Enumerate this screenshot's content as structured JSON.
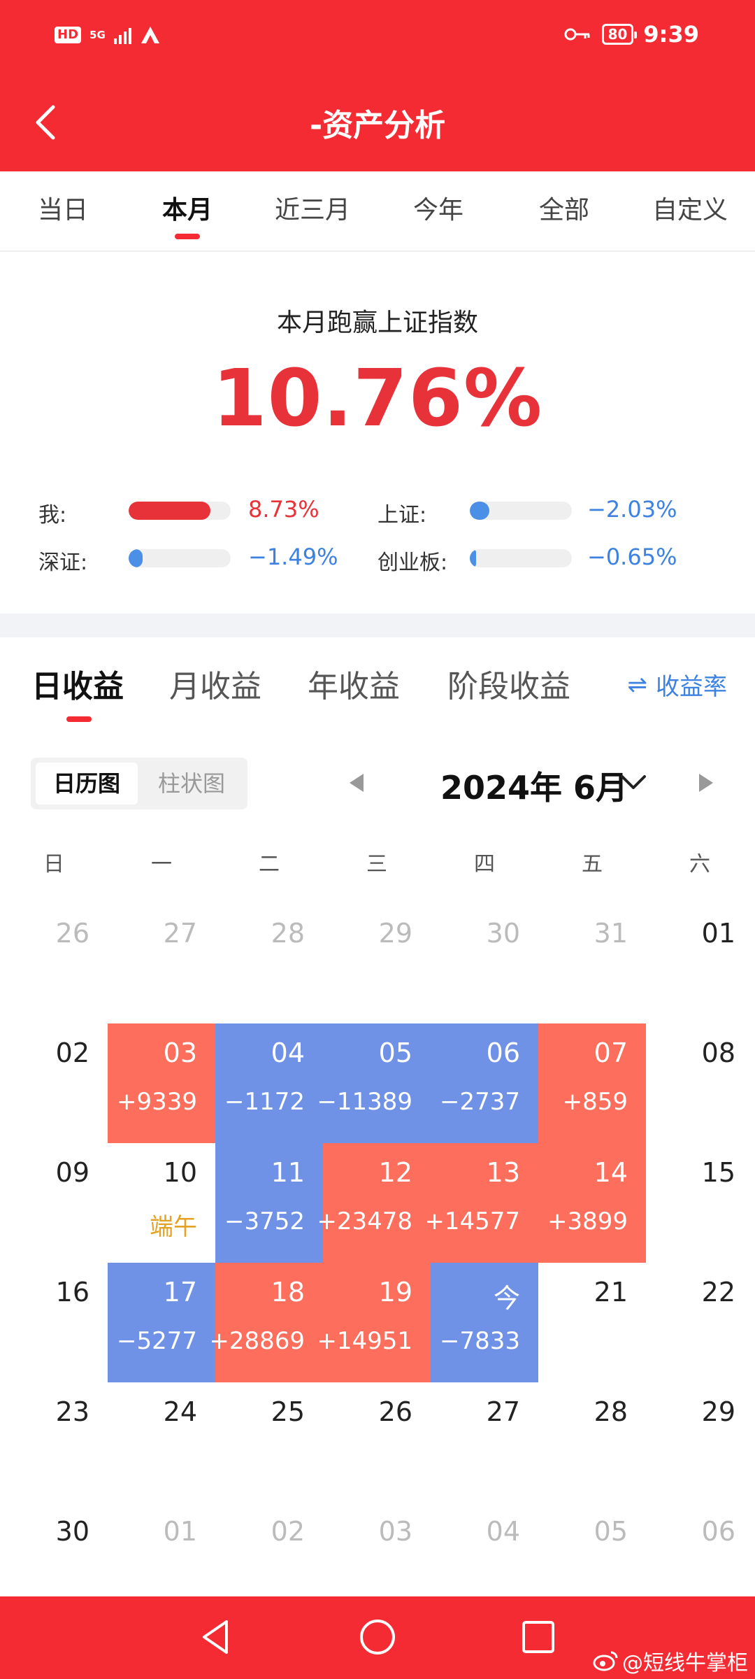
{
  "status_bar": {
    "hd": "HD",
    "network": "5G",
    "battery": "80",
    "time": "9:39"
  },
  "header": {
    "title": "-资产分析"
  },
  "period_tabs": [
    "当日",
    "本月",
    "近三月",
    "今年",
    "全部",
    "自定义"
  ],
  "period_tab_active": "本月",
  "summary": {
    "caption": "本月跑赢上证指数",
    "value": "10.76%"
  },
  "comparisons": [
    {
      "label": "我:",
      "value": "8.73%",
      "color": "#e8323a",
      "level": 0.8
    },
    {
      "label": "上证:",
      "value": "−2.03%",
      "color": "#4c8fe6",
      "level": 0.19
    },
    {
      "label": "深证:",
      "value": "−1.49%",
      "color": "#4c8fe6",
      "level": 0.14
    },
    {
      "label": "创业板:",
      "value": "−0.65%",
      "color": "#4c8fe6",
      "level": 0.05
    }
  ],
  "profit_tabs": [
    "日收益",
    "月收益",
    "年收益",
    "阶段收益"
  ],
  "profit_tab_active": "日收益",
  "yield_toggle": {
    "icon": "⇌",
    "label": "收益率"
  },
  "view_switch": {
    "options": [
      "日历图",
      "柱状图"
    ],
    "active": "日历图"
  },
  "month_nav": {
    "label": "2024年 6月"
  },
  "weekdays": [
    "日",
    "一",
    "二",
    "三",
    "四",
    "五",
    "六"
  ],
  "calendar": [
    [
      {
        "day": "26",
        "muted": true
      },
      {
        "day": "27",
        "muted": true
      },
      {
        "day": "28",
        "muted": true
      },
      {
        "day": "29",
        "muted": true
      },
      {
        "day": "30",
        "muted": true
      },
      {
        "day": "31",
        "muted": true
      },
      {
        "day": "01"
      }
    ],
    [
      {
        "day": "02"
      },
      {
        "day": "03",
        "profit": "+9339",
        "type": "gain"
      },
      {
        "day": "04",
        "profit": "−1172",
        "type": "loss"
      },
      {
        "day": "05",
        "profit": "−11389",
        "type": "loss"
      },
      {
        "day": "06",
        "profit": "−2737",
        "type": "loss"
      },
      {
        "day": "07",
        "profit": "+859",
        "type": "gain"
      },
      {
        "day": "08"
      }
    ],
    [
      {
        "day": "09"
      },
      {
        "day": "10",
        "profit": "端午",
        "type": "holiday"
      },
      {
        "day": "11",
        "profit": "−3752",
        "type": "loss"
      },
      {
        "day": "12",
        "profit": "+23478",
        "type": "gain"
      },
      {
        "day": "13",
        "profit": "+14577",
        "type": "gain"
      },
      {
        "day": "14",
        "profit": "+3899",
        "type": "gain"
      },
      {
        "day": "15"
      }
    ],
    [
      {
        "day": "16"
      },
      {
        "day": "17",
        "profit": "−5277",
        "type": "loss"
      },
      {
        "day": "18",
        "profit": "+28869",
        "type": "gain"
      },
      {
        "day": "19",
        "profit": "+14951",
        "type": "gain"
      },
      {
        "day": "今",
        "profit": "−7833",
        "type": "loss"
      },
      {
        "day": "21"
      },
      {
        "day": "22"
      }
    ],
    [
      {
        "day": "23"
      },
      {
        "day": "24"
      },
      {
        "day": "25"
      },
      {
        "day": "26"
      },
      {
        "day": "27"
      },
      {
        "day": "28"
      },
      {
        "day": "29"
      }
    ],
    [
      {
        "day": "30"
      },
      {
        "day": "01",
        "muted": true
      },
      {
        "day": "02",
        "muted": true
      },
      {
        "day": "03",
        "muted": true
      },
      {
        "day": "04",
        "muted": true
      },
      {
        "day": "05",
        "muted": true
      },
      {
        "day": "06",
        "muted": true
      }
    ]
  ],
  "watermark": "@短线牛掌柜",
  "colors": {
    "brand_red": "#f52b33",
    "gain": "#fd6e5c",
    "loss": "#6f92e6",
    "holiday_text": "#e3a223"
  }
}
